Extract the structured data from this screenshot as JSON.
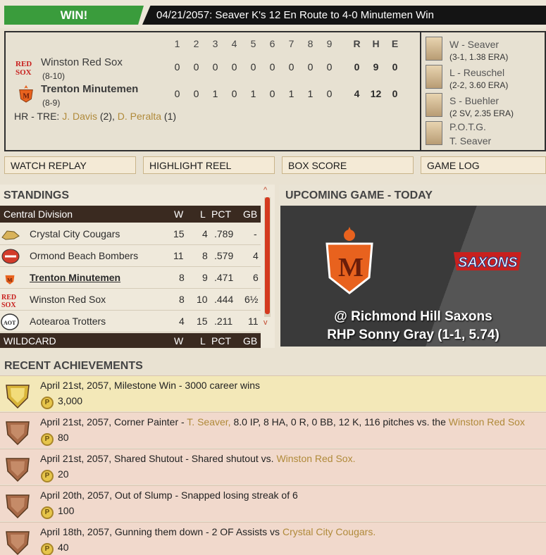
{
  "header": {
    "result": "WIN!",
    "headline": "04/21/2057: Seaver K's 12 En Route to 4-0 Minutemen Win"
  },
  "scoreboard": {
    "innings": [
      "1",
      "2",
      "3",
      "4",
      "5",
      "6",
      "7",
      "8",
      "9"
    ],
    "rhe_headers": [
      "R",
      "H",
      "E"
    ],
    "teams": [
      {
        "name": "Winston Red Sox",
        "record": "(8-10)",
        "logo": "red-sox-logo",
        "innings": [
          "0",
          "0",
          "0",
          "0",
          "0",
          "0",
          "0",
          "0",
          "0"
        ],
        "rhe": [
          "0",
          "9",
          "0"
        ]
      },
      {
        "name": "Trenton Minutemen",
        "record": "(8-9)",
        "logo": "minutemen-logo",
        "innings": [
          "0",
          "0",
          "1",
          "0",
          "1",
          "0",
          "1",
          "1",
          "0"
        ],
        "rhe": [
          "4",
          "12",
          "0"
        ]
      }
    ],
    "hr_label": "HR - TRE:",
    "hr_players": [
      {
        "name": "J. Davis",
        "count": "(2),"
      },
      {
        "name": "D. Peralta",
        "count": "(1)"
      }
    ],
    "decisions": [
      {
        "label": "W - Seaver",
        "sub": "(3-1, 1.38 ERA)"
      },
      {
        "label": "L - Reuschel",
        "sub": "(2-2, 3.60 ERA)"
      },
      {
        "label": "S - Buehler",
        "sub": "(2 SV, 2.35 ERA)"
      },
      {
        "label": "P.O.T.G.",
        "sub": "T. Seaver"
      }
    ]
  },
  "actions": {
    "watch_replay": "WATCH REPLAY",
    "highlight_reel": "HIGHLIGHT REEL",
    "box_score": "BOX SCORE",
    "game_log": "GAME LOG"
  },
  "standings": {
    "title": "STANDINGS",
    "division": "Central Division",
    "columns": [
      "W",
      "L",
      "PCT",
      "GB"
    ],
    "rows": [
      {
        "team": "Crystal City Cougars",
        "w": "15",
        "l": "4",
        "pct": ".789",
        "gb": "-"
      },
      {
        "team": "Ormond Beach Bombers",
        "w": "11",
        "l": "8",
        "pct": ".579",
        "gb": "4"
      },
      {
        "team": "Trenton Minutemen",
        "w": "8",
        "l": "9",
        "pct": ".471",
        "gb": "6"
      },
      {
        "team": "Winston Red Sox",
        "w": "8",
        "l": "10",
        "pct": ".444",
        "gb": "6½"
      },
      {
        "team": "Aotearoa Trotters",
        "w": "4",
        "l": "15",
        "pct": ".211",
        "gb": "11"
      }
    ],
    "wildcard": "WILDCARD",
    "scroll_up": "^",
    "scroll_down": "v"
  },
  "upcoming": {
    "title": "UPCOMING GAME - TODAY",
    "opponent_logo": "SAXONS",
    "home_logo_letter": "M",
    "matchup": "@ Richmond Hill Saxons",
    "pitcher": "RHP Sonny Gray (1-1, 5.74)"
  },
  "achievements": {
    "title": "RECENT ACHIEVEMENTS",
    "coin_symbol": "P",
    "items": [
      {
        "date": "April 21st, 2057, Milestone Win - 3000 career wins",
        "extra": "",
        "link": "",
        "tail": "",
        "link2": "",
        "points": "3,000",
        "badge": "gold"
      },
      {
        "date": "April 21st, 2057, Corner Painter - ",
        "link": "T. Seaver,",
        "extra": " 8.0 IP, 8 HA, 0 R, 0 BB, 12 K, 116 pitches vs. the ",
        "link2": "Winston Red Sox",
        "tail": "",
        "points": "80",
        "badge": "bronze"
      },
      {
        "date": "April 21st, 2057, Shared Shutout - Shared shutout vs. ",
        "link": "Winston Red Sox.",
        "extra": "",
        "link2": "",
        "tail": "",
        "points": "20",
        "badge": "bronze"
      },
      {
        "date": "April 20th, 2057, Out of Slump - Snapped losing streak of 6",
        "link": "",
        "extra": "",
        "link2": "",
        "tail": "",
        "points": "100",
        "badge": "bronze"
      },
      {
        "date": "April 18th, 2057, Gunning them down - 2 OF Assists vs ",
        "link": "Crystal City Cougars.",
        "extra": "",
        "link2": "",
        "tail": "",
        "points": "40",
        "badge": "bronze"
      }
    ]
  },
  "colors": {
    "win_green": "#3a9c3c",
    "link_gold": "#b08a3a",
    "standings_header": "#3a2a20",
    "minutemen_orange": "#e8621e",
    "achievement_gold_row": "#f3e8b8",
    "achievement_row": "#f1d9cc"
  }
}
